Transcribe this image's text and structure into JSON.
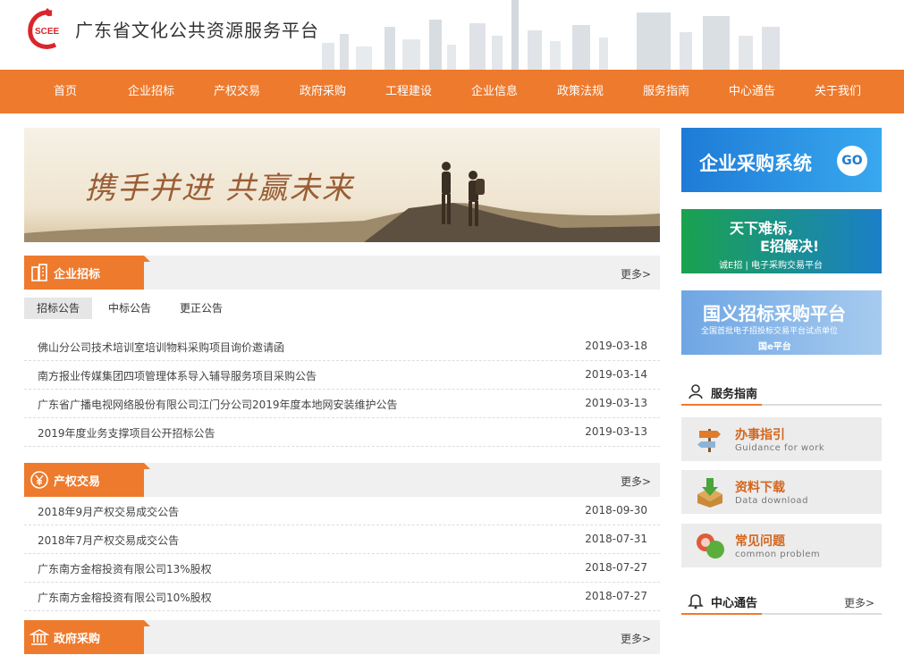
{
  "header": {
    "title": "广东省文化公共资源服务平台",
    "logo_text": "SCEE"
  },
  "nav": [
    "首页",
    "企业招标",
    "产权交易",
    "政府采购",
    "工程建设",
    "企业信息",
    "政策法规",
    "服务指南",
    "中心通告",
    "关于我们"
  ],
  "banner": {
    "text": "携手并进  共赢未来"
  },
  "sections": {
    "tender": {
      "title": "企业招标",
      "more": "更多>",
      "tabs": [
        "招标公告",
        "中标公告",
        "更正公告"
      ],
      "rows": [
        {
          "title": "佛山分公司技术培训室培训物料采购项目询价邀请函",
          "date": "2019-03-18"
        },
        {
          "title": "南方报业传媒集团四项管理体系导入辅导服务项目采购公告",
          "date": "2019-03-14"
        },
        {
          "title": "广东省广播电视网络股份有限公司江门分公司2019年度本地网安装维护公告",
          "date": "2019-03-13"
        },
        {
          "title": "2019年度业务支撑项目公开招标公告",
          "date": "2019-03-13"
        }
      ]
    },
    "property": {
      "title": "产权交易",
      "more": "更多>",
      "rows": [
        {
          "title": "2018年9月产权交易成交公告",
          "date": "2018-09-30"
        },
        {
          "title": "2018年7月产权交易成交公告",
          "date": "2018-07-31"
        },
        {
          "title": "广东南方金榕投资有限公司13%股权",
          "date": "2018-07-27"
        },
        {
          "title": "广东南方金榕投资有限公司10%股权",
          "date": "2018-07-27"
        }
      ]
    },
    "gov": {
      "title": "政府采购",
      "more": "更多>"
    }
  },
  "side": {
    "banner1": {
      "title": "企业采购系统",
      "go": "GO"
    },
    "banner2": {
      "line1": "天下难标，",
      "line2": "E招解决!",
      "foot": "诚E招 | 电子采购交易平台"
    },
    "banner3": {
      "line1": "国义招标采购平台",
      "line2": "全国首批电子招投标交易平台试点单位",
      "line3": "国e平台"
    },
    "guide_head": "服务指南",
    "guides": [
      {
        "cn": "办事指引",
        "en": "Guidance for work"
      },
      {
        "cn": "资料下载",
        "en": "Data download"
      },
      {
        "cn": "常见问题",
        "en": "common problem"
      }
    ],
    "notice_head": "中心通告",
    "notice_more": "更多>"
  },
  "colors": {
    "accent": "#ee7a2d",
    "panel": "#f0f0f0"
  }
}
